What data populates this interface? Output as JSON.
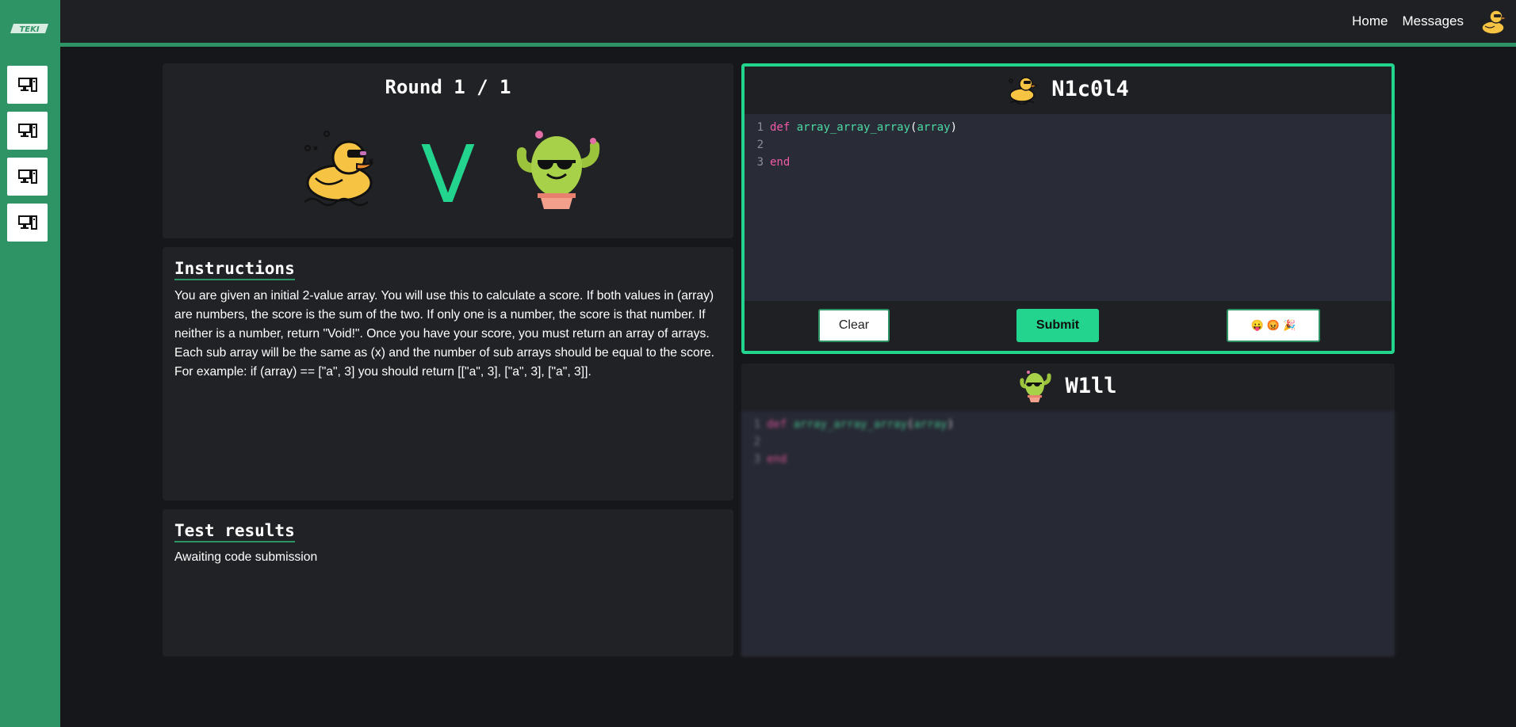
{
  "sidebar": {
    "logo_text": "TEKI",
    "items": [
      {
        "icon": "computer-icon"
      },
      {
        "icon": "computer-icon"
      },
      {
        "icon": "computer-icon"
      },
      {
        "icon": "computer-icon"
      }
    ]
  },
  "topbar": {
    "home_label": "Home",
    "messages_label": "Messages",
    "avatar_icon": "duck-avatar-icon"
  },
  "round": {
    "title": "Round 1 / 1",
    "versus_letter": "V",
    "left_icon": "duck-sunglasses-icon",
    "right_icon": "cactus-sunglasses-icon"
  },
  "instructions": {
    "title": "Instructions",
    "text": "You are given an initial 2-value array. You will use this to calculate a score. If both values in (array) are numbers, the score is the sum of the two. If only one is a number, the score is that number. If neither is a number, return \"Void!\". Once you have your score, you must return an array of arrays. Each sub array will be the same as (x) and the number of sub arrays should be equal to the score. For example: if (array) == [\"a\", 3] you should return [[\"a\", 3], [\"a\", 3], [\"a\", 3]]."
  },
  "test_results": {
    "title": "Test results",
    "status": "Awaiting code submission"
  },
  "player1": {
    "name": "N1c0l4",
    "avatar_icon": "duck-avatar-icon",
    "code": {
      "line_numbers": [
        "1",
        "2",
        "3"
      ],
      "keyword_def": "def",
      "function_name": "array_array_array",
      "open_paren": "(",
      "param": "array",
      "close_paren": ")",
      "keyword_end": "end"
    },
    "clear_label": "Clear",
    "submit_label": "Submit",
    "reactions": [
      "😛",
      "😡",
      "🎉"
    ]
  },
  "player2": {
    "name": "W1ll",
    "avatar_icon": "cactus-avatar-icon",
    "code": {
      "line_numbers": [
        "1",
        "2",
        "3"
      ],
      "keyword_def": "def",
      "function_name": "array_array_array",
      "open_paren": "(",
      "param": "array",
      "close_paren": ")",
      "keyword_end": "end"
    }
  },
  "colors": {
    "accent": "#22d48e",
    "sidebar": "#2e9466",
    "background": "#16171b",
    "panel": "#212226",
    "editor": "#292b37",
    "keyword": "#f25aa8",
    "function": "#4cd9a1"
  }
}
